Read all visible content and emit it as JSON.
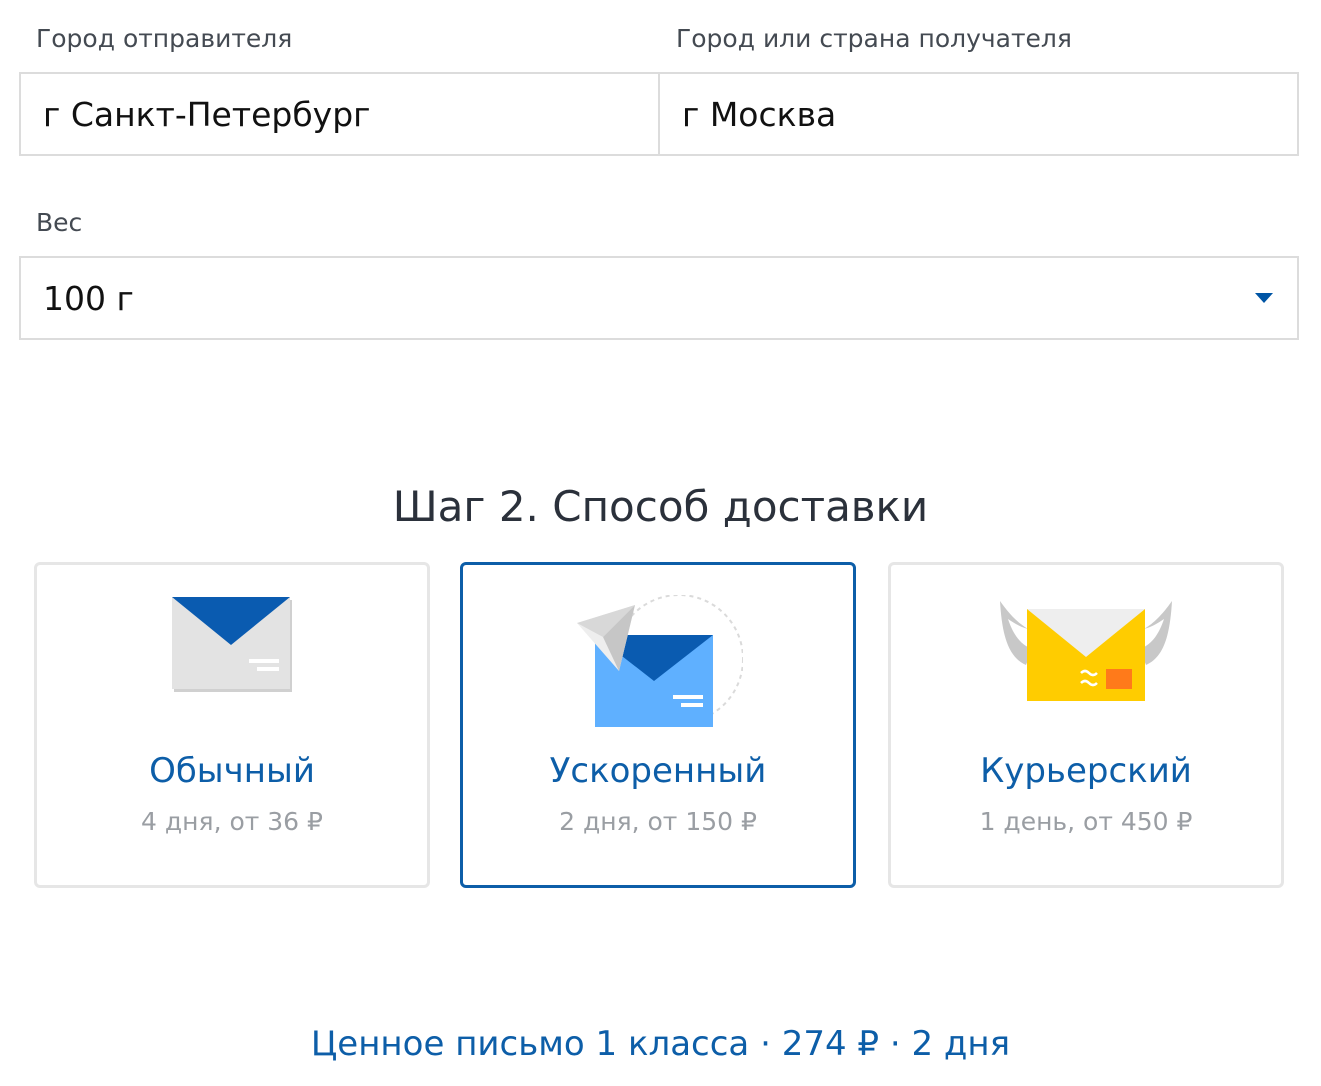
{
  "form": {
    "sender_label": "Город отправителя",
    "sender_value": "г Санкт-Петербург",
    "recipient_label": "Город или страна получателя",
    "recipient_value": "г Москва",
    "weight_label": "Вес",
    "weight_value": "100 г"
  },
  "step": {
    "title": "Шаг 2. Способ доставки"
  },
  "delivery_options": [
    {
      "title": "Обычный",
      "subtitle": "4 дня, от 36 ₽",
      "icon": "envelope-icon",
      "selected": false
    },
    {
      "title": "Ускоренный",
      "subtitle": "2 дня, от 150 ₽",
      "icon": "paper-plane-envelope-icon",
      "selected": true
    },
    {
      "title": "Курьерский",
      "subtitle": "1 день, от 450 ₽",
      "icon": "winged-envelope-icon",
      "selected": false
    }
  ],
  "summary": {
    "text": "Ценное письмо 1 класса · 274 ₽ · 2 дня"
  },
  "colors": {
    "accent": "#0d5ea8",
    "accent_light": "#5fb0ff",
    "gold": "#ffcc00",
    "border": "#dcdcdc",
    "muted_text": "#9a9ea3"
  }
}
